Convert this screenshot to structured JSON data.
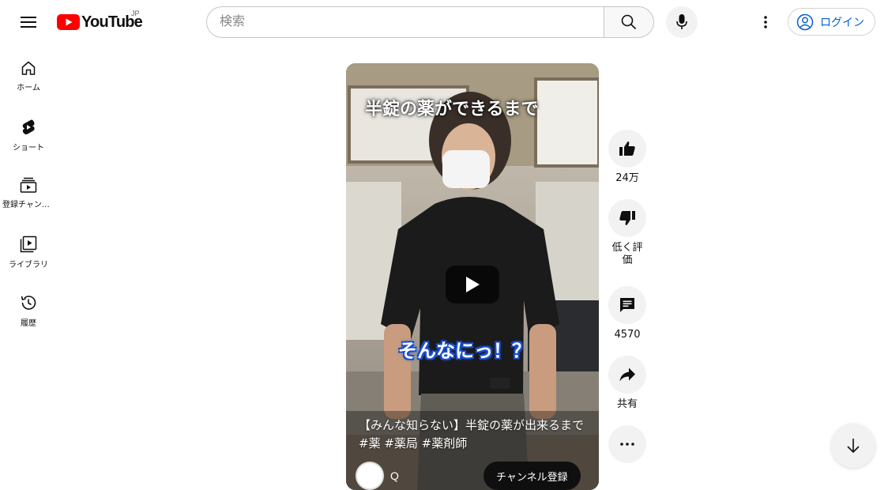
{
  "header": {
    "logo_text": "YouTube",
    "region": "JP",
    "search_placeholder": "検索",
    "login_label": "ログイン"
  },
  "sidebar": {
    "items": [
      {
        "label": "ホーム",
        "icon": "home-icon"
      },
      {
        "label": "ショート",
        "icon": "shorts-icon"
      },
      {
        "label": "登録チャンネル",
        "icon": "subscriptions-icon"
      },
      {
        "label": "ライブラリ",
        "icon": "library-icon"
      },
      {
        "label": "履歴",
        "icon": "history-icon"
      }
    ]
  },
  "video": {
    "overlay_title": "半錠の薬ができるまで",
    "caption": "そんなにっ！？",
    "title": "【みんな知らない】半錠の薬が出来るまで　　#薬 #薬局 #薬剤師",
    "channel_name": "Q",
    "subscribe_label": "チャンネル登録"
  },
  "actions": {
    "like_count": "24万",
    "dislike_label": "低く評価",
    "comment_count": "4570",
    "share_label": "共有"
  },
  "colors": {
    "brand_red": "#ff0000",
    "link_blue": "#065fd4",
    "chip_bg": "#f2f2f2"
  }
}
